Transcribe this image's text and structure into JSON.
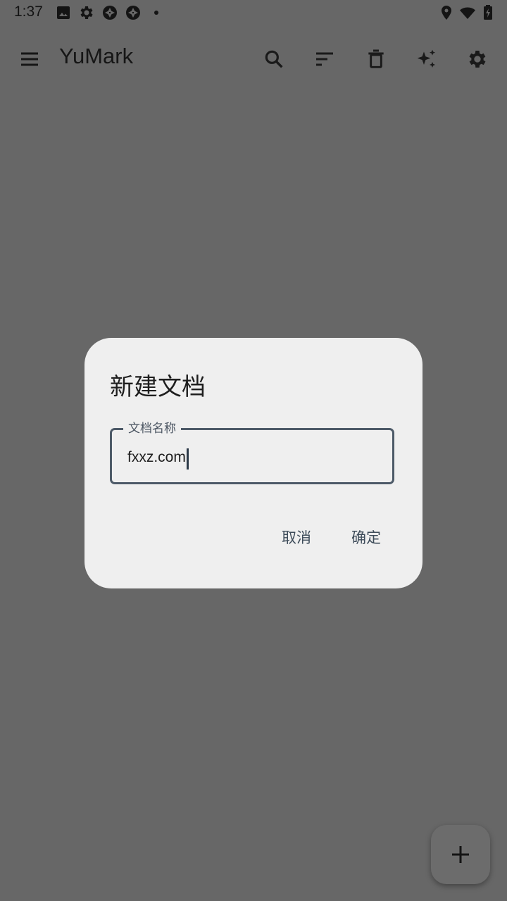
{
  "status_bar": {
    "time": "1:37",
    "left_icons": [
      "image-icon",
      "settings-icon",
      "aperture-icon",
      "aperture-icon",
      "dot-icon"
    ],
    "right_icons": [
      "location-icon",
      "wifi-icon",
      "battery-charging-icon"
    ]
  },
  "app_bar": {
    "title": "YuMark",
    "actions": [
      "search-icon",
      "sort-icon",
      "delete-icon",
      "sparkle-icon",
      "settings-icon"
    ]
  },
  "dialog": {
    "title": "新建文档",
    "field_label": "文档名称",
    "field_value": "fxxz.com",
    "cancel_label": "取消",
    "confirm_label": "确定"
  },
  "fab": {
    "icon": "add-icon"
  },
  "colors": {
    "scrim_background": "#676767",
    "dialog_background": "#efefef",
    "field_outline": "#4d5a68",
    "button_text": "#3e4c5a"
  }
}
